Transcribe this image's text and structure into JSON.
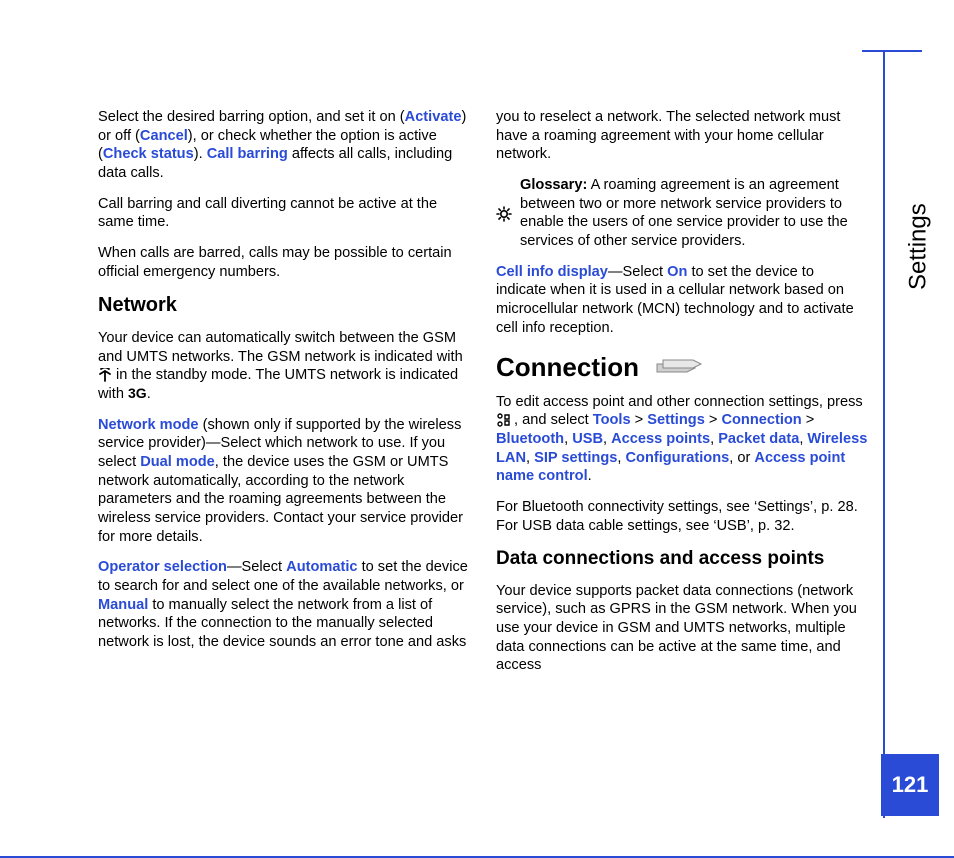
{
  "sideTab": "Settings",
  "pageNumber": "121",
  "left": {
    "p1": {
      "a": "Select the desired barring option, and set it on (",
      "activate": "Activate",
      "b": ") or off (",
      "cancel": "Cancel",
      "c": "), or check whether the option is active (",
      "check": "Check status",
      "d": "). ",
      "callbarring": "Call barring",
      "e": " affects all calls, including data calls."
    },
    "p2": "Call barring and call diverting cannot be active at the same time.",
    "p3": "When calls are barred, calls may be possible to certain official emergency numbers.",
    "h_network": "Network",
    "p4a": "Your device can automatically switch between the GSM and UMTS networks. The GSM network is indicated with ",
    "p4b": " in the standby mode. The UMTS network is indicated with ",
    "p4c": ".",
    "p5": {
      "netmode": "Network mode",
      "a": " (shown only if supported by the wireless service provider)—Select which network to use. If you select ",
      "dual": "Dual mode",
      "b": ", the device uses the GSM or UMTS network automatically, according to the network parameters and the roaming agreements between the wireless service providers. Contact your service provider for more details."
    },
    "p6": {
      "opsel": "Operator selection",
      "a": "—Select ",
      "auto": "Automatic",
      "b": " to set the device to search for and select one of the available networks, or ",
      "manual": "Manual",
      "c": " to manually select the network from a list of networks. If the connection to the manually selected network is lost, the device sounds an error tone and asks"
    }
  },
  "right": {
    "p1": "you to reselect a network. The selected network must have a roaming agreement with your home cellular network.",
    "glossary": {
      "label": "Glossary:",
      "text": " A roaming agreement is an agreement between two or more network service providers to enable the users of one service provider to use the services of other service providers."
    },
    "p2": {
      "cell": "Cell info display",
      "a": "—Select ",
      "on": "On",
      "b": " to set the device to indicate when it is used in a cellular network based on microcellular network (MCN) technology and to activate cell info reception."
    },
    "h_connection": "Connection",
    "p3": {
      "a": "To edit access point and other connection settings, press ",
      "b": " , and select ",
      "tools": "Tools",
      "gt1": " > ",
      "settings": "Settings",
      "gt2": " > ",
      "connection": "Connection",
      "gt3": " > ",
      "bluetooth": "Bluetooth",
      "c1": ", ",
      "usb": "USB",
      "c2": ", ",
      "ap": "Access points",
      "c3": ", ",
      "packet": "Packet data",
      "c4": ", ",
      "wlan": "Wireless LAN",
      "c5": ", ",
      "sip": "SIP settings",
      "c6": ", ",
      "configs": "Configurations",
      "c7": ", or ",
      "apnc": "Access point name control",
      "c8": "."
    },
    "p4": "For Bluetooth connectivity settings, see ‘Settings’, p. 28. For USB data cable settings, see ‘USB’, p. 32.",
    "h_data": "Data connections and access points",
    "p5": "Your device supports packet data connections (network service), such as GPRS in the GSM network. When you use your device in GSM and UMTS networks, multiple data connections can be active at the same time, and access"
  }
}
